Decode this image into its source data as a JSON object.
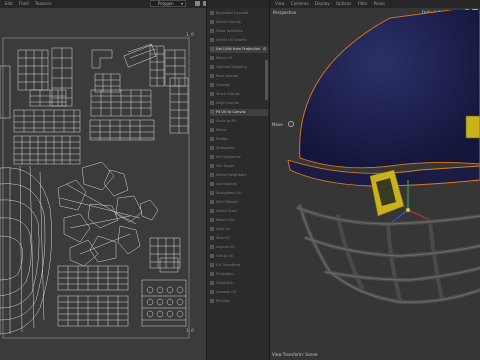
{
  "uv_editor": {
    "menu": [
      "Edit",
      "Fluid",
      "Textures"
    ],
    "view_dropdown": "Polygon",
    "corner_top": "1, 0",
    "corner_bottom": "1, 0"
  },
  "tool_panel": {
    "items": [
      {
        "label": "Keyboard Layouts",
        "selected": false
      },
      {
        "label": "Select Islands",
        "selected": false
      },
      {
        "label": "Grow Selection",
        "selected": false
      },
      {
        "label": "Select UV Seams",
        "selected": false
      },
      {
        "label": "Set UVW from Projection",
        "selected": true,
        "icon": "gear-icon"
      },
      {
        "label": "Relax UV",
        "selected": false
      },
      {
        "label": "Optimal Mapping",
        "selected": false
      },
      {
        "label": "Pack Islands",
        "selected": false
      },
      {
        "label": "Unwrap",
        "selected": false
      },
      {
        "label": "Stack Islands",
        "selected": false
      },
      {
        "label": "Align Islands",
        "selected": false
      },
      {
        "label": "Fit UV to Canvas",
        "selected": true
      },
      {
        "label": "Scale to Fit",
        "selected": false
      },
      {
        "label": "Mirror",
        "selected": false
      },
      {
        "label": "Rotate",
        "selected": false
      },
      {
        "label": "Straighten",
        "selected": false
      },
      {
        "label": "Set Sequence",
        "selected": false
      },
      {
        "label": "Set Target",
        "selected": false
      },
      {
        "label": "Select Neighbors",
        "selected": false
      },
      {
        "label": "Add Islands",
        "selected": false
      },
      {
        "label": "Straighten UV",
        "selected": false
      },
      {
        "label": "Multi Weight",
        "selected": false
      },
      {
        "label": "Island Tools",
        "selected": false
      },
      {
        "label": "Match UVs",
        "selected": false
      },
      {
        "label": "Split UV",
        "selected": false
      },
      {
        "label": "Sew UV",
        "selected": false
      },
      {
        "label": "Layout UV",
        "selected": false
      },
      {
        "label": "Group UV",
        "selected": false
      },
      {
        "label": "UV Transform",
        "selected": false
      },
      {
        "label": "Projection",
        "selected": false
      },
      {
        "label": "Distortion",
        "selected": false
      },
      {
        "label": "Unwrap UV",
        "selected": false
      },
      {
        "label": "Preview",
        "selected": false
      }
    ]
  },
  "viewport": {
    "menu": [
      "View",
      "Cameras",
      "Display",
      "Options",
      "Filter",
      "Panel"
    ],
    "view_name": "Perspective",
    "camera_name": "Default Camera",
    "side_label": "Move",
    "status": "View Transform: Scene",
    "colors": {
      "helmet_shell": "#20244f",
      "helmet_outline": "#e07a1a",
      "grill": "#4a4a4a",
      "strap": "#c9b21b",
      "background": "#363636"
    }
  }
}
